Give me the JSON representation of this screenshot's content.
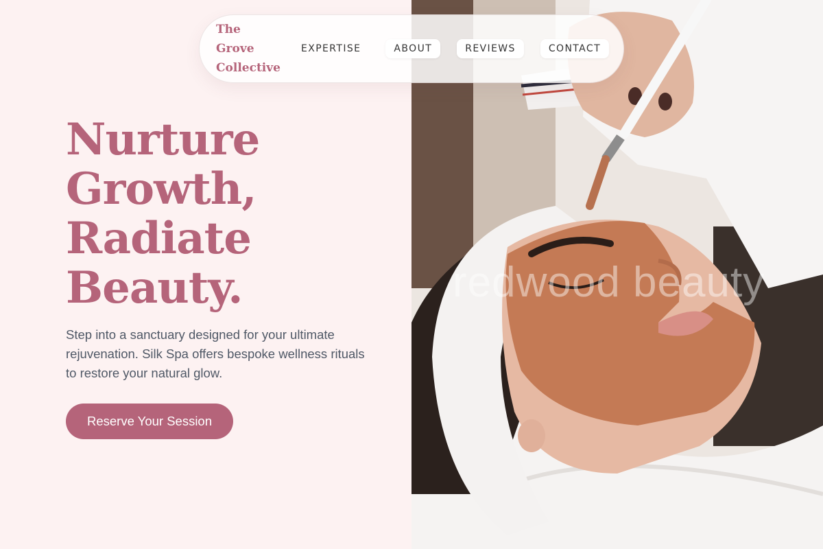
{
  "brand": {
    "line1": "The",
    "line2": "Grove",
    "line3": "Collective"
  },
  "nav": {
    "items": [
      {
        "label": "EXPERTISE"
      },
      {
        "label": "ABOUT"
      },
      {
        "label": "REVIEWS"
      },
      {
        "label": "CONTACT"
      }
    ]
  },
  "hero": {
    "headline": [
      "Nurture",
      "Growth,",
      "Radiate",
      "Beauty."
    ],
    "intro": "Step into a sanctuary designed for your ultimate rejuvenation. Silk Spa offers bespoke wellness rituals to restore your natural glow.",
    "cta_label": "Reserve Your Session"
  },
  "photo": {
    "watermark": "redwood beauty"
  },
  "colors": {
    "accent": "#b5647a",
    "background": "#fdf2f2",
    "body_text": "#4f5866"
  }
}
